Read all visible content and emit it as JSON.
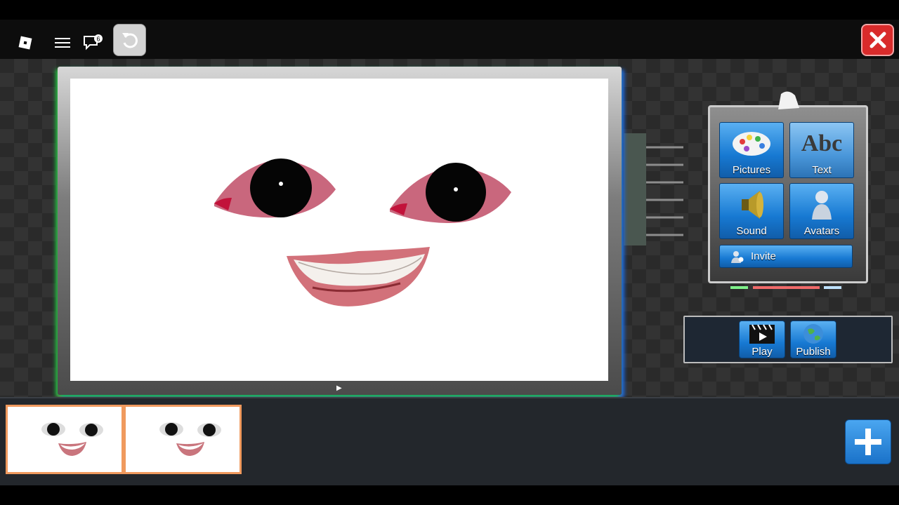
{
  "colors": {
    "close": "#d92b2b",
    "tool_button": "#1779d2",
    "thumb_border": "#f09a5e",
    "add_button": "#2b8be0"
  },
  "topbar": {
    "icons": [
      "roblox-logo-icon",
      "menu-icon",
      "chat-icon",
      "undo-icon",
      "close-icon"
    ],
    "chat_badge": "6"
  },
  "tools": {
    "pictures_label": "Pictures",
    "text_label": "Text",
    "text_icon_glyph": "Abc",
    "sound_label": "Sound",
    "avatars_label": "Avatars",
    "invite_label": "Invite"
  },
  "actions": {
    "play_label": "Play",
    "publish_label": "Publish"
  },
  "filmstrip": {
    "frames": 2
  }
}
